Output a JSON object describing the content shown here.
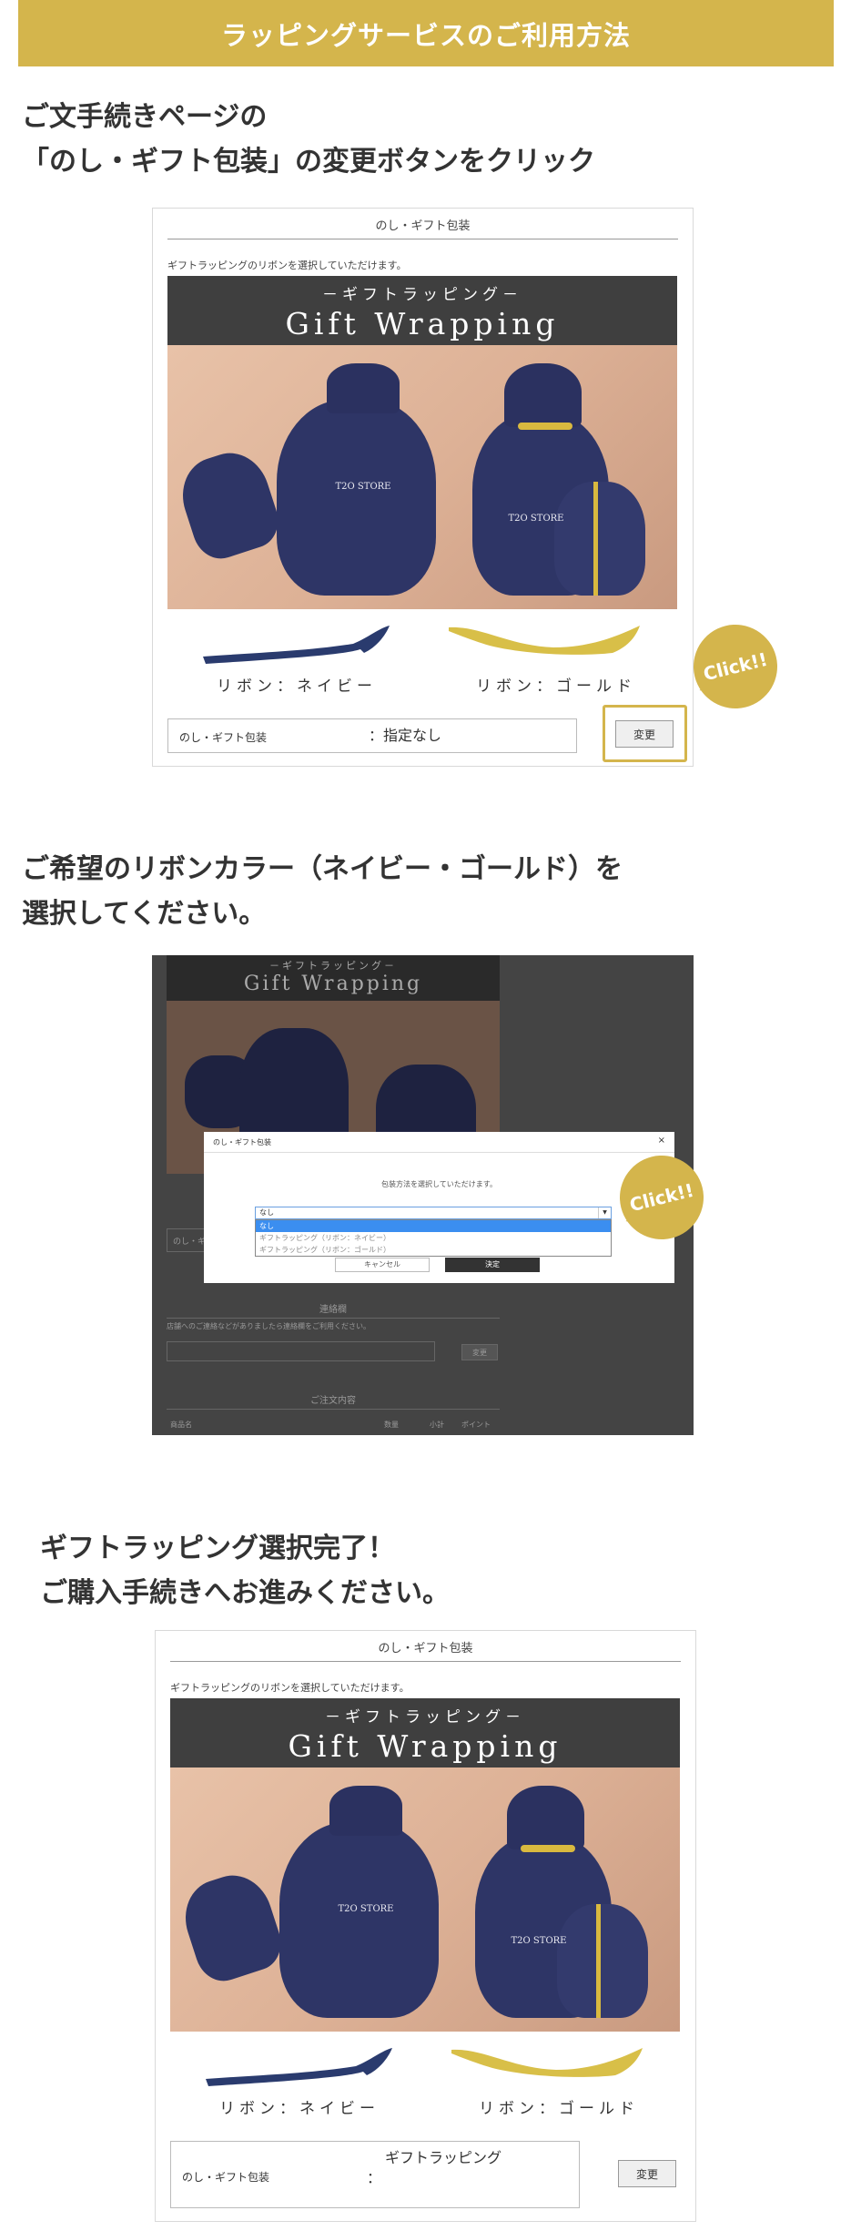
{
  "banner": {
    "title": "ラッピングサービスのご利用方法"
  },
  "step1": {
    "heading_line1": "ご文手続きページの",
    "heading_line2": "「のし・ギフト包装」の変更ボタンをクリック"
  },
  "step2": {
    "heading_line1": "ご希望のリボンカラー（ネイビー・ゴールド）を",
    "heading_line2": "選択してください。"
  },
  "step3": {
    "heading_line1": "ギフトラッピング選択完了！",
    "heading_line2": "ご購入手続きへお進みください。"
  },
  "card": {
    "title": "のし・ギフト包装",
    "description": "ギフトラッピングのリボンを選択していただけます。",
    "gw_sub": "－ギフトラッピング－",
    "gw_main": "Gift Wrapping",
    "brand_text": "T2O STORE",
    "ribbon_navy": "リボン：ネイビー",
    "ribbon_gold": "リボン：ゴールド",
    "option_label": "のし・ギフト包装",
    "option_value_before": "：指定なし",
    "option_colon": "：",
    "option_value_after": "ギフトラッピング",
    "change_button": "変更",
    "click_badge": "Click!!"
  },
  "modal": {
    "title": "のし・ギフト包装",
    "close": "×",
    "instruction": "包装方法を選択していただけます。",
    "select_value": "なし",
    "options": [
      "なし",
      "ギフトラッピング（リボン：ネイビー）",
      "ギフトラッピング（リボン：ゴールド）"
    ],
    "cancel_button": "キャンセル",
    "ok_button": "決定"
  },
  "background_form": {
    "section_contact": "連絡欄",
    "contact_desc": "店舗へのご連絡などがありましたら連絡欄をご利用ください。",
    "change_button": "変更",
    "section_order": "ご注文内容",
    "col_product": "商品名",
    "col_qty": "数量",
    "col_subtotal": "小計",
    "col_point": "ポイント",
    "option_label": "のし・ギフト包装"
  },
  "colors": {
    "accent": "#d4b54c",
    "navy": "#2e3566",
    "dark_header": "#3f3f3f",
    "select_highlight": "#3b8ef0"
  }
}
